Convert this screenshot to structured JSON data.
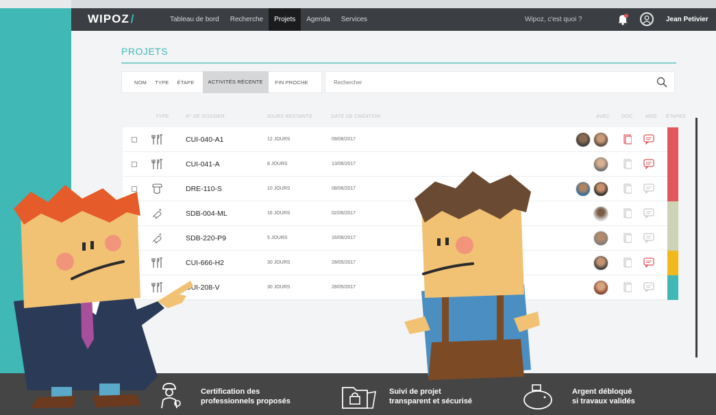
{
  "header": {
    "logo": "WIPOZ",
    "logo_slash": "/",
    "nav": [
      "Tableau de bord",
      "Recherche",
      "Projets",
      "Agenda",
      "Services"
    ],
    "active_nav": "Projets",
    "question": "Wipoz, c'est quoi ?",
    "user_name": "Jean Petivier"
  },
  "page": {
    "title": "PROJETS"
  },
  "filters": {
    "nom": "NOM",
    "type": "TYPE",
    "etape": "ÉTAPE",
    "recente": "ACTIVITÉS RÉCENTE",
    "fin": "FIN PROCHE"
  },
  "search": {
    "placeholder": "Rechercher"
  },
  "table": {
    "headers": {
      "type": "TYPE",
      "dossier": "N° DE DOSSIER",
      "jours": "JOURS RESTANTS",
      "date": "DATE DE CRÉATION",
      "avec": "AVEC",
      "doc": "DOC",
      "msg": "MSG",
      "etapes": "ÉTAPES"
    },
    "rows": [
      {
        "icon": "tools-icon",
        "dossier": "CUI-040-A1",
        "jours": "12 JOURS",
        "date": "09/06/2017",
        "doc_active": true,
        "msg_active": true,
        "stage_color": "#e0575c"
      },
      {
        "icon": "tools-icon",
        "dossier": "CUI-041-A",
        "jours": "8 JOURS",
        "date": "13/06/2017",
        "doc_active": false,
        "msg_active": true,
        "stage_color": "#e0575c"
      },
      {
        "icon": "paint-icon",
        "dossier": "DRE-110-S",
        "jours": "10 JOURS",
        "date": "08/06/2017",
        "doc_active": false,
        "msg_active": false,
        "stage_color": "#e0575c"
      },
      {
        "icon": "pipe-icon",
        "dossier": "SDB-004-ML",
        "jours": "16 JOURS",
        "date": "02/06/2017",
        "doc_active": false,
        "msg_active": false,
        "stage_color": "#cfd3b6"
      },
      {
        "icon": "pipe-icon",
        "dossier": "SDB-220-P9",
        "jours": "5 JOURS",
        "date": "16/06/2017",
        "doc_active": false,
        "msg_active": false,
        "stage_color": "#cfd3b6"
      },
      {
        "icon": "tools-icon",
        "dossier": "CUI-666-H2",
        "jours": "30 JOURS",
        "date": "28/05/2017",
        "doc_active": false,
        "msg_active": true,
        "stage_color": "#f2b91e"
      },
      {
        "icon": "tools-icon",
        "dossier": "CUI-208-V",
        "jours": "30 JOURS",
        "date": "28/05/2017",
        "doc_active": false,
        "msg_active": false,
        "stage_color": "#3fb8b6"
      }
    ]
  },
  "features": [
    {
      "icon": "certified-worker-icon",
      "line1": "Certification des",
      "line2": "professionnels proposés"
    },
    {
      "icon": "secure-folder-icon",
      "line1": "Suivi de projet",
      "line2": "transparent et sécurisé"
    },
    {
      "icon": "piggy-bank-icon",
      "line1": "Argent débloqué",
      "line2": "si travaux validés"
    }
  ],
  "colors": {
    "accent": "#3fb8b6",
    "nav_bg": "#3b3e42",
    "alert_red": "#e0575c"
  }
}
